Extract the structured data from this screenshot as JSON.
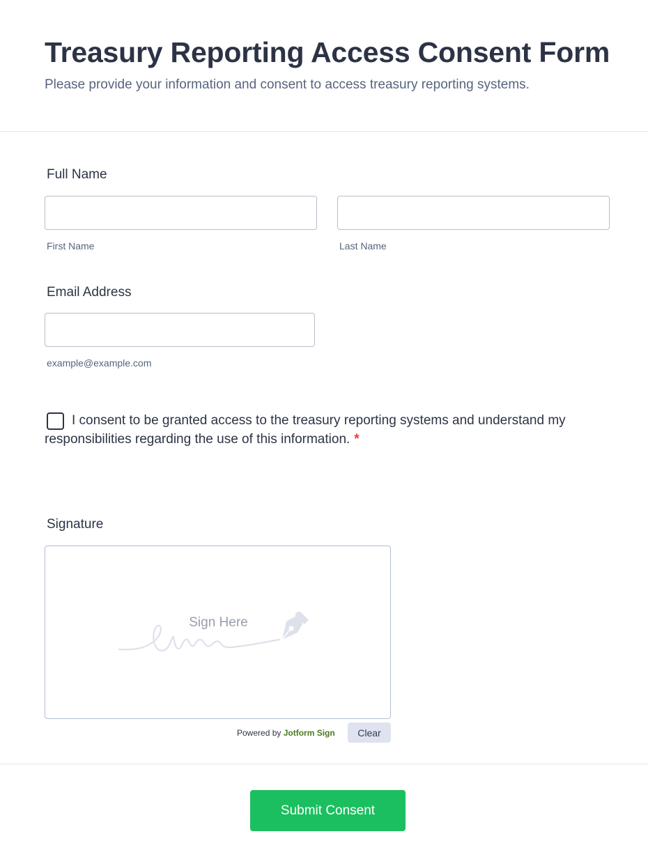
{
  "header": {
    "title": "Treasury Reporting Access Consent Form",
    "subtitle": "Please provide your information and consent to access treasury reporting systems."
  },
  "full_name": {
    "label": "Full Name",
    "first": {
      "value": "",
      "sublabel": "First Name"
    },
    "last": {
      "value": "",
      "sublabel": "Last Name"
    }
  },
  "email": {
    "label": "Email Address",
    "value": "",
    "sublabel": "example@example.com"
  },
  "consent": {
    "checked": false,
    "text": "I consent to be granted access to the treasury reporting systems and understand my responsibilities regarding the use of this information.",
    "required_mark": "*"
  },
  "signature": {
    "label": "Signature",
    "placeholder": "Sign Here",
    "powered_by": "Powered by",
    "brand": "Jotform Sign",
    "clear_label": "Clear"
  },
  "submit": {
    "label": "Submit Consent"
  },
  "colors": {
    "submit": "#1bbf5f",
    "required": "#f23a3c",
    "brand": "#4a7a1e",
    "clear_button": "#dfe3f0"
  }
}
